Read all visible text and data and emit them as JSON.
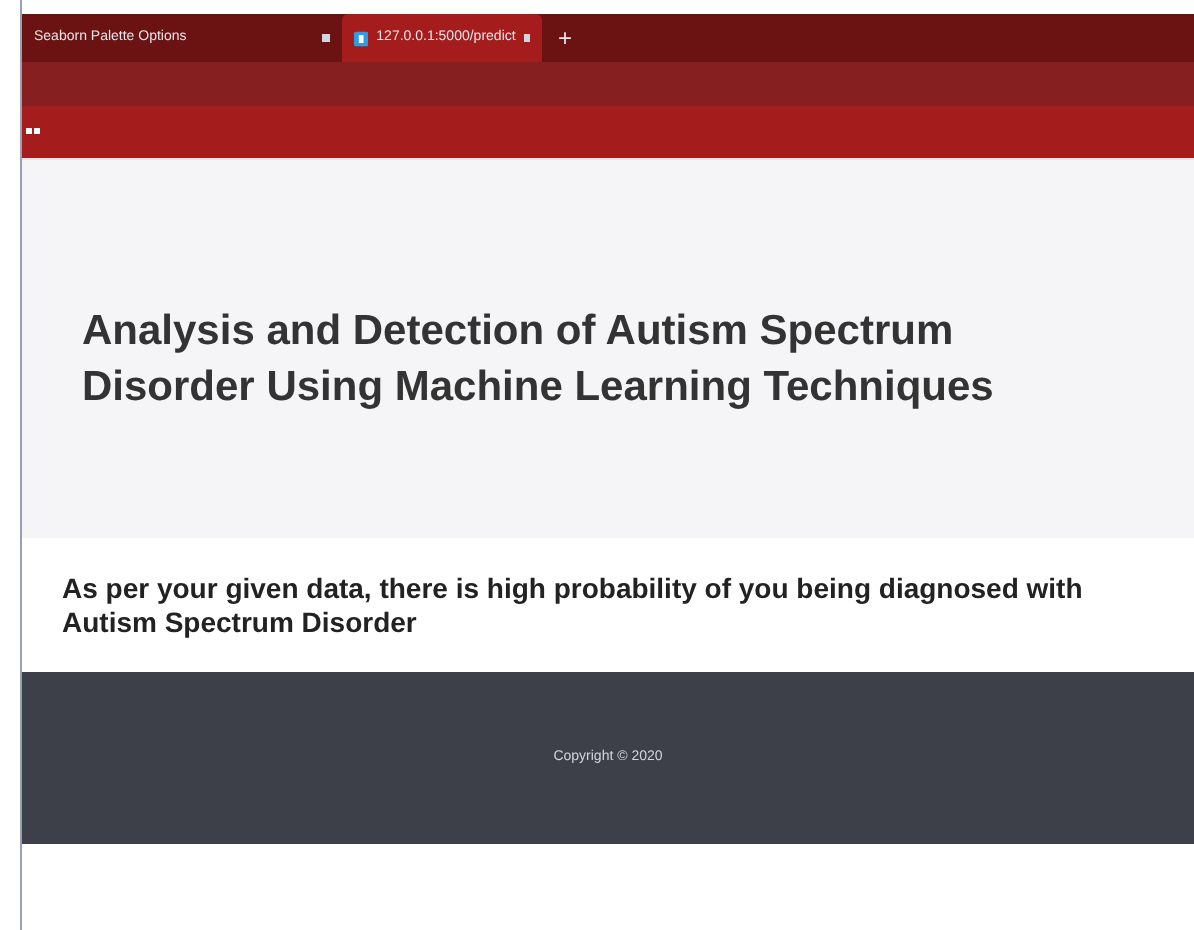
{
  "tabs": [
    {
      "label": "Seaborn Palette Options",
      "selected": false
    },
    {
      "label": "127.0.0.1:5000/predict",
      "selected": true
    }
  ],
  "new_tab": "+",
  "hero": {
    "title": "Analysis and Detection of Autism Spectrum Disorder Using Machine Learning Techniques"
  },
  "result": {
    "message": "As per your given data, there is high probability of you being diagnosed with Autism Spectrum Disorder"
  },
  "footer": {
    "copyright": "Copyright © 2020"
  }
}
